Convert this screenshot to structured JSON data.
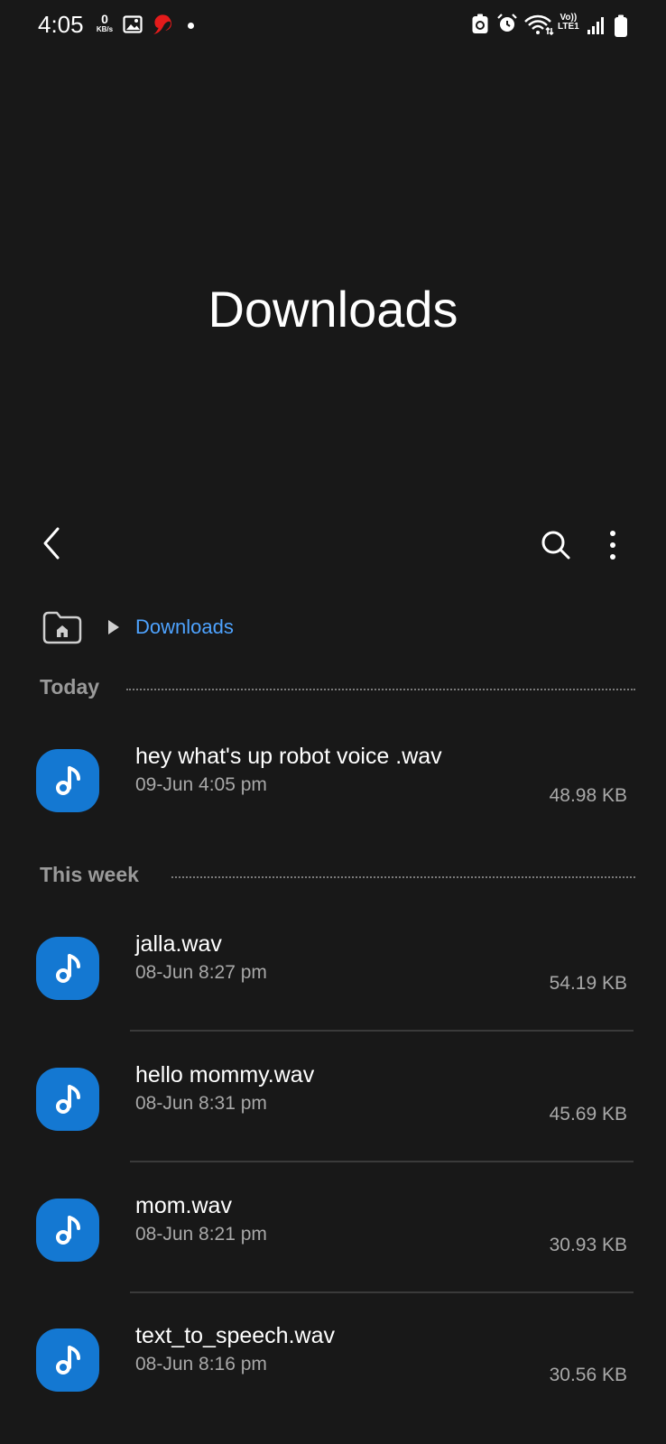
{
  "status_bar": {
    "time": "4:05",
    "net_speed_value": "0",
    "net_speed_unit": "KB/s",
    "volte_top": "Vo))",
    "volte_bottom": "LTE1"
  },
  "header": {
    "title": "Downloads"
  },
  "breadcrumb": {
    "current": "Downloads"
  },
  "sections": [
    {
      "label": "Today",
      "files": [
        {
          "name": "hey what's up robot voice .wav",
          "date": "09-Jun 4:05 pm",
          "size": "48.98 KB"
        }
      ]
    },
    {
      "label": "This week",
      "files": [
        {
          "name": "jalla.wav",
          "date": "08-Jun 8:27 pm",
          "size": "54.19 KB"
        },
        {
          "name": "hello mommy.wav",
          "date": "08-Jun 8:31 pm",
          "size": "45.69 KB"
        },
        {
          "name": "mom.wav",
          "date": "08-Jun 8:21 pm",
          "size": "30.93 KB"
        },
        {
          "name": "text_to_speech.wav",
          "date": "08-Jun 8:16 pm",
          "size": "30.56 KB"
        }
      ]
    }
  ],
  "icons": {
    "file_type": "music-note-icon",
    "back": "chevron-left-icon",
    "search": "search-icon",
    "more": "more-vertical-icon",
    "home": "home-folder-icon"
  },
  "colors": {
    "background": "#181818",
    "accent": "#4ea3ff",
    "file_icon": "#1478d2",
    "secondary_text": "#a8a8a8"
  }
}
